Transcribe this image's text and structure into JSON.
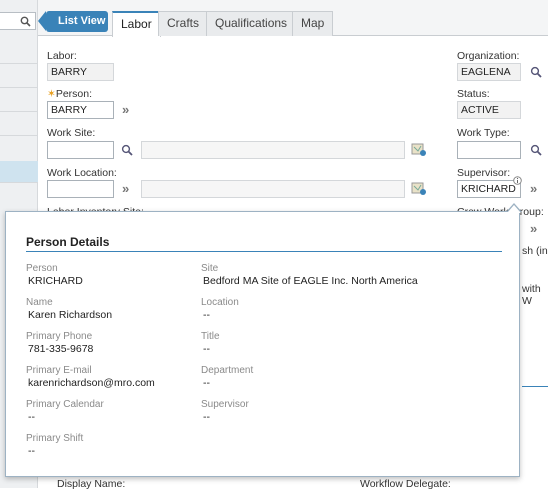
{
  "tabs": {
    "list_view": "List View",
    "items": [
      "Labor",
      "Crafts",
      "Qualifications",
      "Map"
    ]
  },
  "form": {
    "labor": {
      "label": "Labor:",
      "value": "BARRY"
    },
    "person": {
      "label": "Person:",
      "value": "BARRY"
    },
    "work_site": {
      "label": "Work Site:",
      "value": ""
    },
    "work_location": {
      "label": "Work Location:",
      "value": ""
    },
    "labor_inventory_site": {
      "label": "Labor Inventory Site:"
    },
    "organization": {
      "label": "Organization:",
      "value": "EAGLENA"
    },
    "status": {
      "label": "Status:",
      "value": "ACTIVE"
    },
    "work_type": {
      "label": "Work Type:",
      "value": ""
    },
    "supervisor": {
      "label": "Supervisor:",
      "value": "KRICHARD"
    },
    "crew_work_group": {
      "label": "Crew Work Group:"
    },
    "partial_text_1": "sh (in",
    "partial_text_2": "with W"
  },
  "person_details": {
    "title": "Person Details",
    "fields": [
      {
        "label": "Person",
        "value": "KRICHARD"
      },
      {
        "label": "Site",
        "value": "Bedford MA Site of EAGLE Inc. North America"
      },
      {
        "label": "Name",
        "value": "Karen Richardson"
      },
      {
        "label": "Location",
        "value": "--"
      },
      {
        "label": "Primary Phone",
        "value": "781-335-9678"
      },
      {
        "label": "Title",
        "value": "--"
      },
      {
        "label": "Primary E-mail",
        "value": "karenrichardson@mro.com"
      },
      {
        "label": "Department",
        "value": "--"
      },
      {
        "label": "Primary Calendar",
        "value": "--"
      },
      {
        "label": "Supervisor",
        "value": "--"
      },
      {
        "label": "Primary Shift",
        "value": "--"
      }
    ]
  },
  "bottom": {
    "display_name": "Display Name:",
    "workflow_delegate": "Workflow Delegate:"
  },
  "colors": {
    "accent": "#3a83b8"
  }
}
